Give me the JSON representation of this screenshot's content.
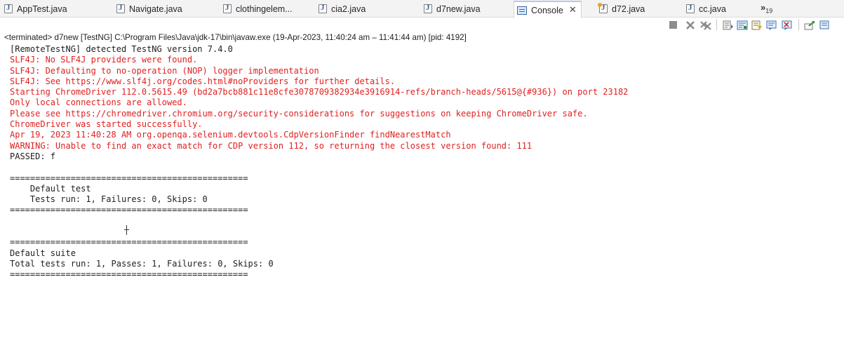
{
  "tabs": [
    {
      "label": "AppTest.java",
      "icon": "java-file-icon"
    },
    {
      "label": "Navigate.java",
      "icon": "java-file-icon"
    },
    {
      "label": "clothingelem...",
      "icon": "java-file-icon"
    },
    {
      "label": "cia2.java",
      "icon": "java-file-icon"
    },
    {
      "label": "d7new.java",
      "icon": "java-file-icon"
    },
    {
      "label": "Console",
      "icon": "console-icon",
      "close": "✕"
    },
    {
      "label": "d72.java",
      "icon": "java-file-icon"
    },
    {
      "label": "cc.java",
      "icon": "java-file-icon"
    }
  ],
  "overflow": {
    "chevrons": "»",
    "count": "19"
  },
  "status": "<terminated> d7new [TestNG] C:\\Program Files\\Java\\jdk-17\\bin\\javaw.exe  (19-Apr-2023, 11:40:24 am – 11:41:44 am) [pid: 4192]",
  "console": [
    {
      "text": "[RemoteTestNG] detected TestNG version 7.4.0",
      "color": "black"
    },
    {
      "text": "SLF4J: No SLF4J providers were found.",
      "color": "red"
    },
    {
      "text": "SLF4J: Defaulting to no-operation (NOP) logger implementation",
      "color": "red"
    },
    {
      "text": "SLF4J: See https://www.slf4j.org/codes.html#noProviders for further details.",
      "color": "red"
    },
    {
      "text": "Starting ChromeDriver 112.0.5615.49 (bd2a7bcb881c11e8cfe3078709382934e3916914-refs/branch-heads/5615@{#936}) on port 23182",
      "color": "red"
    },
    {
      "text": "Only local connections are allowed.",
      "color": "red"
    },
    {
      "text": "Please see https://chromedriver.chromium.org/security-considerations for suggestions on keeping ChromeDriver safe.",
      "color": "red"
    },
    {
      "text": "ChromeDriver was started successfully.",
      "color": "red"
    },
    {
      "text": "Apr 19, 2023 11:40:28 AM org.openqa.selenium.devtools.CdpVersionFinder findNearestMatch",
      "color": "red"
    },
    {
      "text": "WARNING: Unable to find an exact match for CDP version 112, so returning the closest version found: 111",
      "color": "red"
    },
    {
      "text": "PASSED: f",
      "color": "black"
    },
    {
      "text": "",
      "color": "black"
    },
    {
      "text": "===============================================",
      "color": "black"
    },
    {
      "text": "    Default test",
      "color": "black"
    },
    {
      "text": "    Tests run: 1, Failures: 0, Skips: 0",
      "color": "black"
    },
    {
      "text": "===============================================",
      "color": "black"
    },
    {
      "text": "",
      "color": "black"
    },
    {
      "text": "",
      "color": "black"
    },
    {
      "text": "===============================================",
      "color": "black"
    },
    {
      "text": "Default suite",
      "color": "black"
    },
    {
      "text": "Total tests run: 1, Passes: 1, Failures: 0, Skips: 0",
      "color": "black"
    },
    {
      "text": "===============================================",
      "color": "black"
    }
  ],
  "colors": {
    "error": "#e02020",
    "normal": "#1e1e1e",
    "tab_accent": "#b9c8e8"
  }
}
